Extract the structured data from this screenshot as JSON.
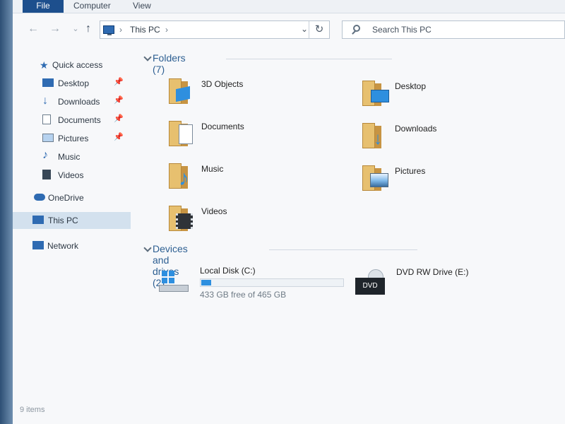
{
  "ribbon": {
    "tabs": [
      "File",
      "Computer",
      "View"
    ]
  },
  "address_bar": {
    "location": "This PC"
  },
  "search": {
    "placeholder": "Search This PC"
  },
  "sidebar": {
    "items": [
      {
        "label": "Quick access"
      },
      {
        "label": "Desktop"
      },
      {
        "label": "Downloads"
      },
      {
        "label": "Documents"
      },
      {
        "label": "Pictures"
      },
      {
        "label": "Music"
      },
      {
        "label": "Videos"
      },
      {
        "label": "OneDrive"
      },
      {
        "label": "This PC"
      },
      {
        "label": "Network"
      }
    ]
  },
  "folders": {
    "title": "Folders (7)",
    "items": [
      {
        "label": "3D Objects"
      },
      {
        "label": "Desktop"
      },
      {
        "label": "Documents"
      },
      {
        "label": "Downloads"
      },
      {
        "label": "Music"
      },
      {
        "label": "Pictures"
      },
      {
        "label": "Videos"
      }
    ]
  },
  "drives": {
    "title": "Devices and drives (2)",
    "items": [
      {
        "label": "Local Disk (C:)",
        "free": "433 GB free of 465 GB",
        "used_fraction": 0.069
      },
      {
        "label": "DVD RW Drive (E:)"
      }
    ]
  },
  "status": {
    "text": "9 items"
  },
  "colors": {
    "accent": "#2E8FDF",
    "ribbon_file": "#1D4F8D",
    "selected_row": "#D3E1EE"
  }
}
